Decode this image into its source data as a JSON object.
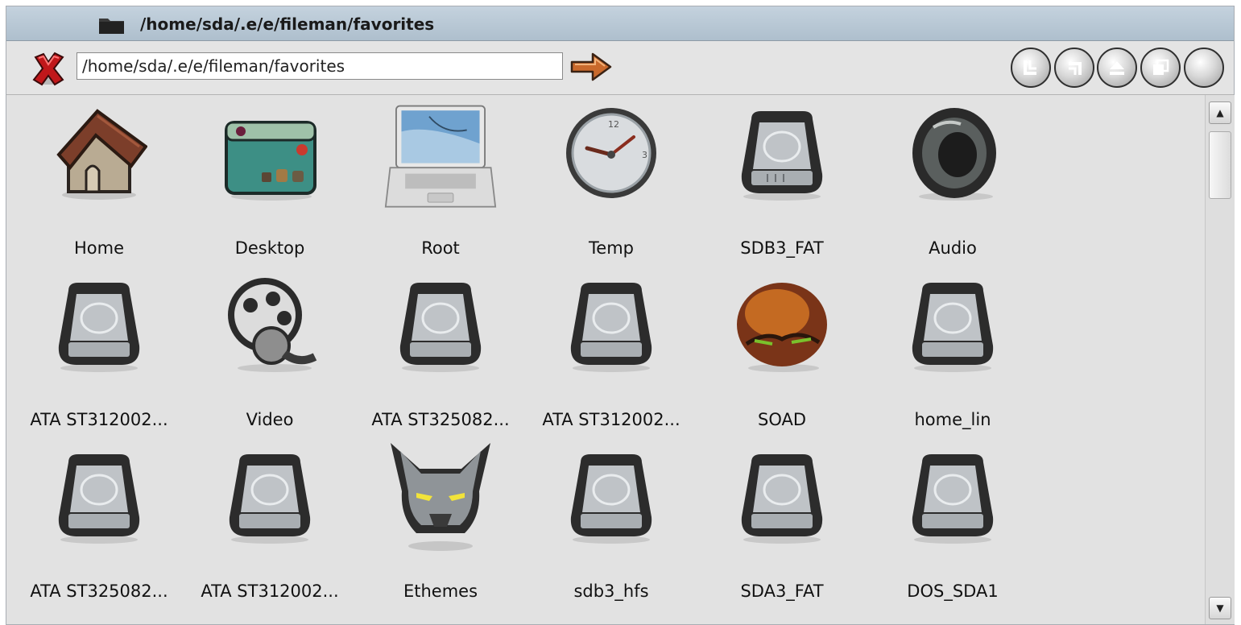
{
  "window": {
    "title": "/home/sda/.e/e/fileman/favorites"
  },
  "toolbar": {
    "path_value": "/home/sda/.e/e/fileman/favorites",
    "buttons": [
      {
        "name": "layout-icons-button",
        "icon": "grid-layout-icon"
      },
      {
        "name": "layout-list-button",
        "icon": "list-layout-icon"
      },
      {
        "name": "eject-button",
        "icon": "eject-icon"
      },
      {
        "name": "copy-button",
        "icon": "copy-icon"
      },
      {
        "name": "blank-button",
        "icon": "blank-icon"
      }
    ]
  },
  "items": [
    {
      "label": "Home",
      "icon": "house-icon"
    },
    {
      "label": "Desktop",
      "icon": "desktop-icon"
    },
    {
      "label": "Root",
      "icon": "laptop-icon"
    },
    {
      "label": "Temp",
      "icon": "clock-icon"
    },
    {
      "label": "SDB3_FAT",
      "icon": "hard-drive-icon"
    },
    {
      "label": "Audio",
      "icon": "speaker-icon"
    },
    {
      "label": "ATA ST312002...",
      "icon": "hard-drive-icon"
    },
    {
      "label": "Video",
      "icon": "film-reel-icon"
    },
    {
      "label": "ATA ST325082...",
      "icon": "hard-drive-icon"
    },
    {
      "label": "ATA ST312002...",
      "icon": "hard-drive-icon"
    },
    {
      "label": "SOAD",
      "icon": "creature-icon"
    },
    {
      "label": "home_lin",
      "icon": "hard-drive-icon"
    },
    {
      "label": "ATA ST325082...",
      "icon": "hard-drive-icon"
    },
    {
      "label": "ATA ST312002...",
      "icon": "hard-drive-icon"
    },
    {
      "label": "Ethemes",
      "icon": "wolf-icon"
    },
    {
      "label": "sdb3_hfs",
      "icon": "hard-drive-icon"
    },
    {
      "label": "SDA3_FAT",
      "icon": "hard-drive-icon"
    },
    {
      "label": "DOS_SDA1",
      "icon": "hard-drive-icon"
    }
  ]
}
